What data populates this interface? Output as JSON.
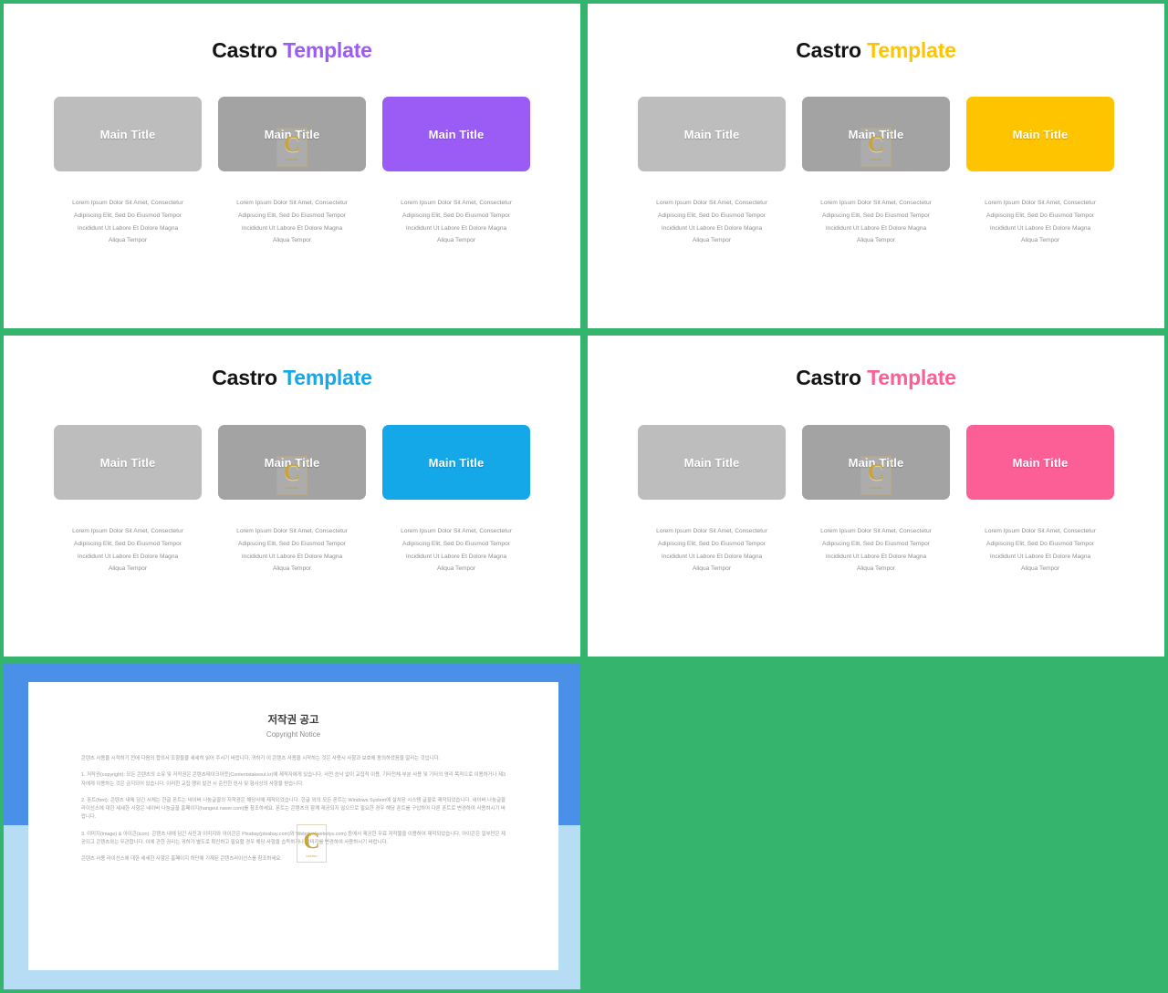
{
  "background_color": "#35b46e",
  "watermark": {
    "letter": "C",
    "sublabel": "CASTRO"
  },
  "card_colors": {
    "neutral_light": "#bdbdbd",
    "neutral_dark": "#a3a3a3"
  },
  "common": {
    "brand": "Castro",
    "template_word": "Template",
    "card_label": "Main Title",
    "caption_lines": [
      "Lorem Ipsum Dolor Sit Amet, Consectetur",
      "Adipiscing Elit, Sed Do Eiusmod Tempor",
      "Incididunt Ut Labore Et Dolore Magna",
      "Aliqua Tempor"
    ]
  },
  "slides": [
    {
      "id": "slide-purple",
      "accent_color": "#9b5cf6",
      "accent_name": "purple"
    },
    {
      "id": "slide-amber",
      "accent_color": "#ffc400",
      "accent_name": "amber"
    },
    {
      "id": "slide-blue",
      "accent_color": "#14a8e8",
      "accent_name": "blue"
    },
    {
      "id": "slide-pink",
      "accent_color": "#fc5f96",
      "accent_name": "pink"
    }
  ],
  "document": {
    "frame_color_top": "#4a90e8",
    "frame_color_bottom": "#b7ddf5",
    "title_ko": "저작권 공고",
    "title_en": "Copyright Notice",
    "intro": "콘텐츠 사용을 시작하기 전에 다음의 합의서 조항들을 세세히 읽어 주시기 바랍니다. 귀하가 이 콘텐츠 사용을 시작하는 것은 사용시 사항과 보호에 동의하셨음을 알리는 것입니다.",
    "clause1": "1. 저작권(copyright): 모든 콘텐츠의 소유 및 저작권은 콘텐츠테이크아웃(Contentstakeout.kr)에 제작자에게 있습니다. 사전 승낙 없이 교집적 이용, 기타전체·부분 사용 및 기타의 영리 목적으로 이용하거나 제3자에게 이용하는 것은 금지되어 있습니다. 이러한 교집 행위 발견 시 준민한 민사 및 형사상의 사항을 받습니다.",
    "clause2": "2. 폰트(font): 콘텐츠 내에 담긴 서체는 한글 폰트는 네이버 나눔글꼴의 저작권은 해당사에 제작되었습니다. 한글 외의 모든 폰트는 Windows System에 설치된 시스템 글꼴로 제작되었습니다. 네이버 나눔글꼴 라이선스에 대한 세세한 사항은 네이버 나눔글꼴 홈페이지(hangeul.naver.com)를 참조하세요. 폰트는 콘텐츠의 함께 제공되지 않으므로 필요한 경우 해당 폰트를 구입하여 다른 폰트로 변경하여 사용하시기 바랍니다.",
    "clause3": "3. 이미지(image) & 아이콘(icon): 콘텐츠 내에 담긴 사진과 이미지와 아이콘은 Pixabay(pixabay.com)와 Webolys(webolys.com) 등에서 제공한 무료 저작물을 이용하여 제작되었습니다. 아이콘은 일부만은 제공되고 콘텐츠와는 무관합니다. 이에 관한 권리는 귀하가 별도로 확인하고 필요할 경우 해당 사항을 습득하거나 이미지를 변경하여 사용하시기 바랍니다.",
    "footer": "콘텐츠 사용 라이선스에 대한 세세한 사항은 홈페이지 하단에 기재된 콘텐츠라이선스를 참조하세요."
  }
}
